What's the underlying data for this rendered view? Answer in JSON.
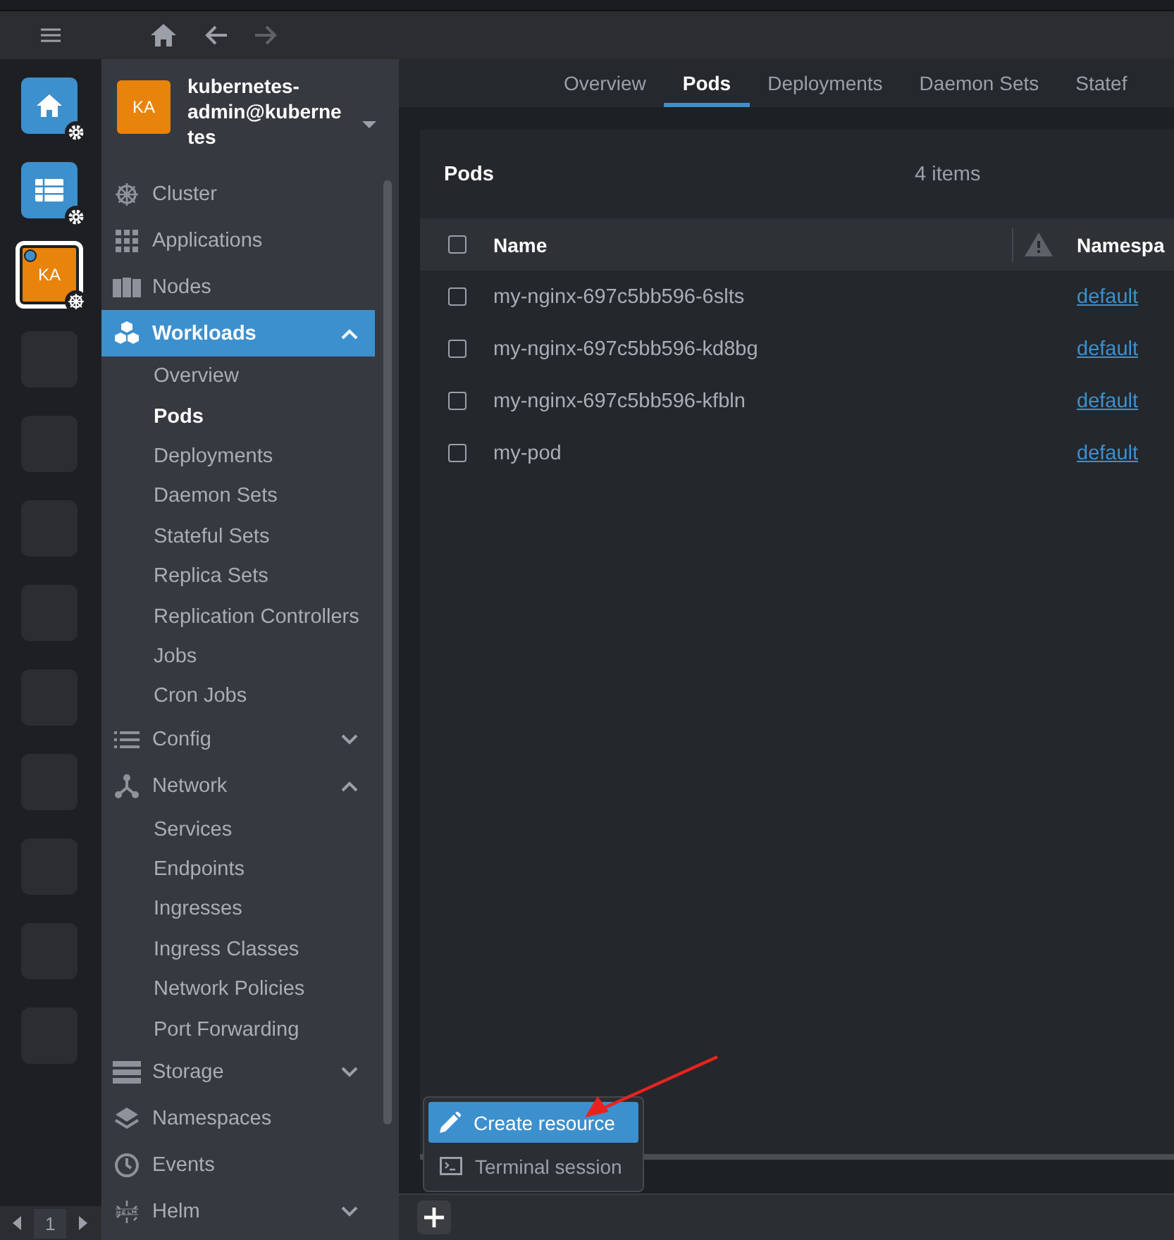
{
  "toolbar": {
    "buttons": [
      {
        "kind": "menu"
      },
      {
        "kind": "home"
      },
      {
        "kind": "back",
        "disabled": false
      },
      {
        "kind": "forward",
        "disabled": true
      }
    ]
  },
  "hotbar": {
    "items": [
      {
        "kind": "home"
      },
      {
        "kind": "catalog"
      },
      {
        "kind": "cluster",
        "label": "KA",
        "selected": true
      },
      {
        "kind": "empty"
      },
      {
        "kind": "empty"
      },
      {
        "kind": "empty"
      },
      {
        "kind": "empty"
      },
      {
        "kind": "empty"
      },
      {
        "kind": "empty"
      },
      {
        "kind": "empty"
      },
      {
        "kind": "empty"
      },
      {
        "kind": "empty"
      }
    ],
    "pager": {
      "page": "1"
    }
  },
  "cluster": {
    "initials": "KA",
    "name": "kubernetes-admin@kubernetes"
  },
  "sidebar": {
    "items": [
      {
        "label": "Cluster",
        "kind": "wheel",
        "selected": false
      },
      {
        "label": "Applications",
        "kind": "grid",
        "selected": false
      },
      {
        "label": "Nodes",
        "kind": "servers",
        "selected": false
      },
      {
        "label": "Workloads",
        "kind": "cubes",
        "selected": true,
        "expanded": true,
        "children": [
          {
            "label": "Overview",
            "selected": false
          },
          {
            "label": "Pods",
            "selected": true
          },
          {
            "label": "Deployments",
            "selected": false
          },
          {
            "label": "Daemon Sets",
            "selected": false
          },
          {
            "label": "Stateful Sets",
            "selected": false
          },
          {
            "label": "Replica Sets",
            "selected": false
          },
          {
            "label": "Replication Controllers",
            "selected": false
          },
          {
            "label": "Jobs",
            "selected": false
          },
          {
            "label": "Cron Jobs",
            "selected": false
          }
        ]
      },
      {
        "label": "Config",
        "kind": "list",
        "selected": false,
        "expanded": false
      },
      {
        "label": "Network",
        "kind": "network",
        "selected": false,
        "expanded": true,
        "children": [
          {
            "label": "Services",
            "selected": false
          },
          {
            "label": "Endpoints",
            "selected": false
          },
          {
            "label": "Ingresses",
            "selected": false
          },
          {
            "label": "Ingress Classes",
            "selected": false
          },
          {
            "label": "Network Policies",
            "selected": false
          },
          {
            "label": "Port Forwarding",
            "selected": false
          }
        ]
      },
      {
        "label": "Storage",
        "kind": "storage",
        "selected": false,
        "expanded": false
      },
      {
        "label": "Namespaces",
        "kind": "layers",
        "selected": false
      },
      {
        "label": "Events",
        "kind": "clock",
        "selected": false
      },
      {
        "label": "Helm",
        "kind": "helm",
        "selected": false,
        "expanded": false
      }
    ]
  },
  "tabs": [
    {
      "label": "Overview",
      "selected": false
    },
    {
      "label": "Pods",
      "selected": true
    },
    {
      "label": "Deployments",
      "selected": false
    },
    {
      "label": "Daemon Sets",
      "selected": false
    },
    {
      "label": "Statef",
      "selected": false
    }
  ],
  "panel": {
    "title": "Pods",
    "count": "4 items",
    "columns": [
      {
        "kind": "check",
        "checked": false
      },
      {
        "kind": "text",
        "label": "Name"
      },
      {
        "kind": "warning"
      },
      {
        "kind": "text",
        "label": "Namespa"
      }
    ],
    "rows": [
      {
        "checked": false,
        "name": "my-nginx-697c5bb596-6slts",
        "namespace": "default"
      },
      {
        "checked": false,
        "name": "my-nginx-697c5bb596-kd8bg",
        "namespace": "default"
      },
      {
        "checked": false,
        "name": "my-nginx-697c5bb596-kfbln",
        "namespace": "default"
      },
      {
        "checked": false,
        "name": "my-pod",
        "namespace": "default"
      }
    ]
  },
  "menu": {
    "items": [
      {
        "kind": "create",
        "label": "Create resource",
        "selected": true
      },
      {
        "kind": "terminal",
        "label": "Terminal session",
        "selected": false
      }
    ]
  },
  "annotation": {
    "kind": "arrow"
  },
  "bottom_bar": {
    "buttons": [
      {
        "kind": "add"
      }
    ]
  }
}
